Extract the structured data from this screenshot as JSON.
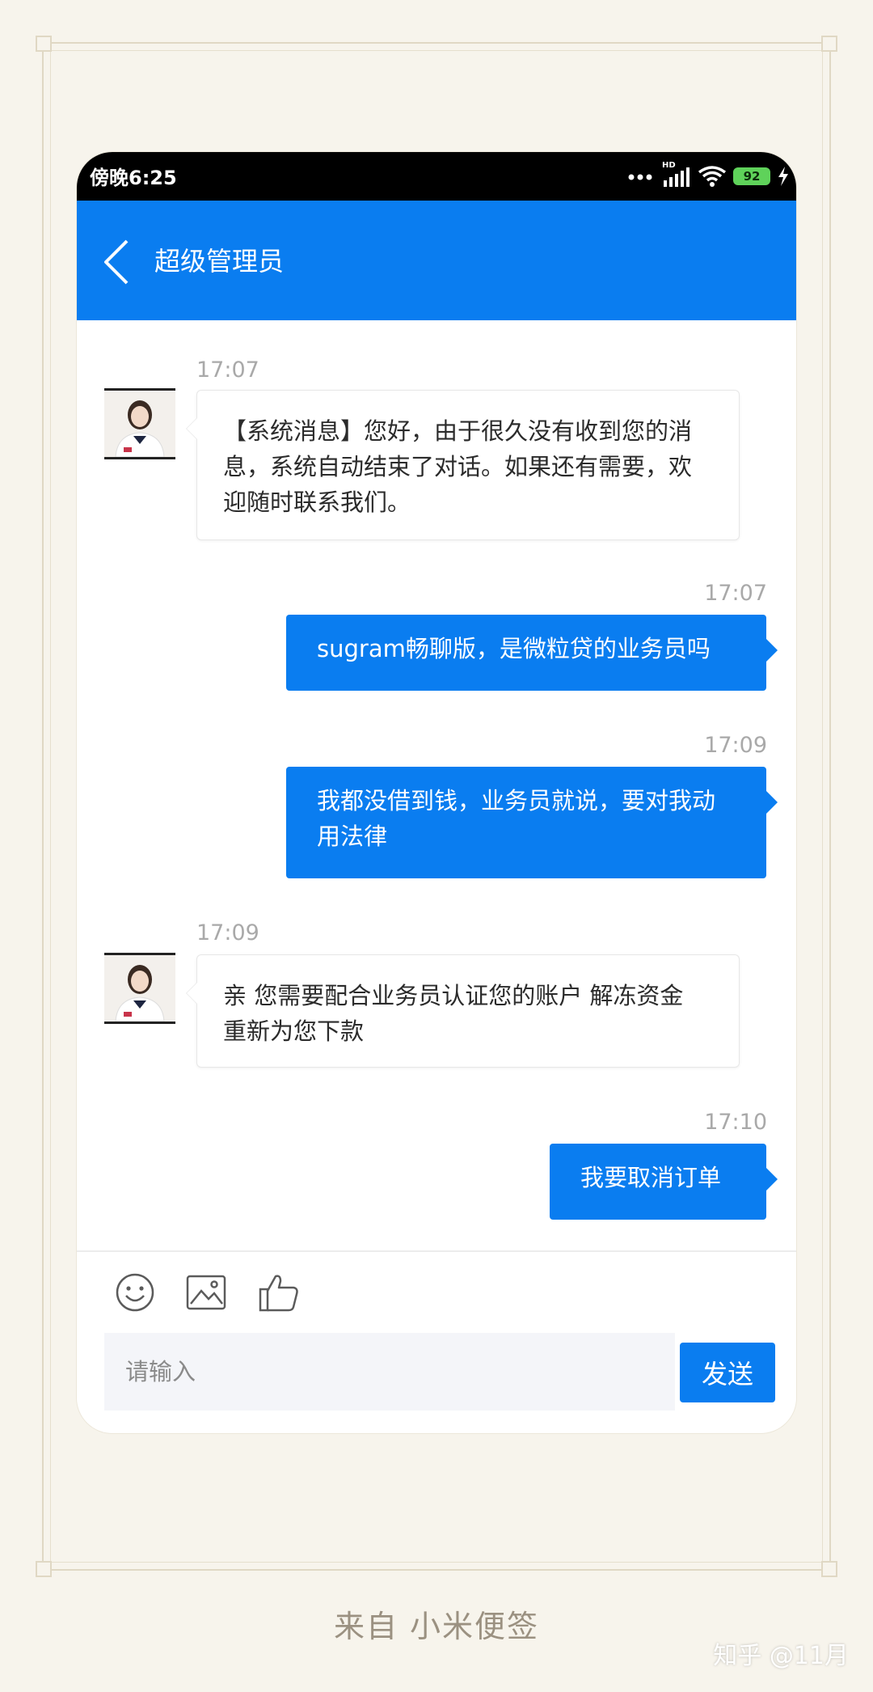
{
  "status_bar": {
    "time": "傍晚6:25",
    "network": "HD",
    "battery": "92"
  },
  "header": {
    "title": "超级管理员"
  },
  "messages": [
    {
      "direction": "in",
      "time": "17:07",
      "text": "【系统消息】您好，由于很久没有收到您的消息，系统自动结束了对话。如果还有需要，欢迎随时联系我们。"
    },
    {
      "direction": "out",
      "time": "17:07",
      "text": "sugram畅聊版，是微粒贷的业务员吗"
    },
    {
      "direction": "out",
      "time": "17:09",
      "text": "我都没借到钱，业务员就说，要对我动用法律"
    },
    {
      "direction": "in",
      "time": "17:09",
      "text": "亲 您需要配合业务员认证您的账户 解冻资金 重新为您下款"
    },
    {
      "direction": "out",
      "time": "17:10",
      "text": "我要取消订单"
    }
  ],
  "toolbar": {
    "icons": [
      "emoji-icon",
      "image-icon",
      "thumbs-up-icon"
    ]
  },
  "input": {
    "placeholder": "请输入",
    "value": ""
  },
  "send_label": "发送",
  "footer": {
    "source": "来自 小米便签",
    "watermark": "知乎 @11月"
  },
  "colors": {
    "accent": "#0a7df0",
    "background": "#f7f4ec",
    "status_bar": "#000000",
    "battery": "#5fd25a"
  }
}
